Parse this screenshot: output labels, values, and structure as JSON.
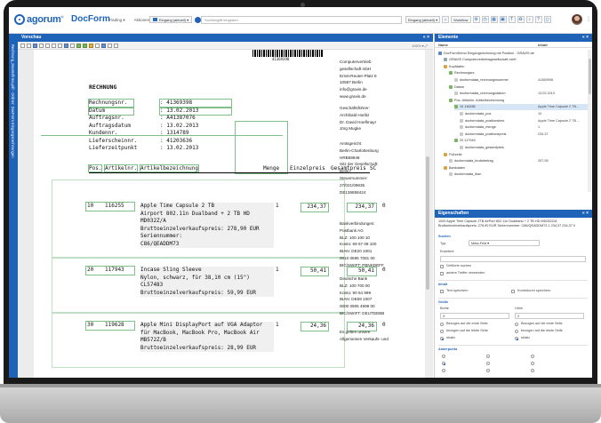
{
  "app": {
    "logo_text": "agorum",
    "logo_sup": "®",
    "name": "DocForm",
    "menu": [
      "Trading ▾",
      "Aktionen ▾"
    ],
    "inbox_label": "Eingang (aktuell) ▾",
    "search_placeholder": "Suchbegriff eingeben",
    "tool_buttons": [
      "Eingang (aktuell) ▾",
      "Workflow"
    ],
    "kebab": "⋮"
  },
  "left_tab": {
    "label": "Rechnung_Musterfirma.pdf - Ordner: DocForm Eingangsrechnungen"
  },
  "viewer": {
    "title": "Vorschau",
    "close": "« ×",
    "zoom": "100%  ▾   ⤢",
    "barcode_number": "41369398",
    "doc_title": "RECHNUNG",
    "meta": [
      {
        "k": "Rechnungsnr.",
        "v": ": 41369398"
      },
      {
        "k": "Datum",
        "v": ": 13.02.2013"
      },
      {
        "k": "Auftragsnr.",
        "v": ": A41387076"
      },
      {
        "k": "Auftragsdatum",
        "v": ": 13.02.2013"
      },
      {
        "k": "Kundennr.",
        "v": ": 1314789"
      },
      {
        "k": "Lieferscheinnr.",
        "v": ": 41203636"
      },
      {
        "k": "Lieferzeitpunkt",
        "v": ": 13.02.2013"
      }
    ],
    "table_head": {
      "pos": "Pos.",
      "art": "Artikelnr.",
      "desc": "Artikelbezeichnung",
      "qty": "Menge",
      "ep": "Einzelpreis",
      "gp": "Gesamtpreis",
      "sc": "SC"
    },
    "items": [
      {
        "pos": "10",
        "art": "116255",
        "lines": [
          "Apple Time Capsule 2 TB",
          "Airport 802.11n Dualband + 2 TB HD",
          "MD032Z/A",
          "Bruttoeinzelverkaufspreis: 278,90 EUR",
          "Seriennummer:",
          "C86/QEADDM73"
        ],
        "qty": "1",
        "ep": "234,37",
        "gp": "234,37",
        "sc": "0"
      },
      {
        "pos": "20",
        "art": "117943",
        "lines": [
          "Incase Sling Sleeve",
          "Nylon, schwarz, für 38,10 cm (15\")",
          "CL57483",
          "Bruttoeinzelverkaufspreis: 59,99 EUR"
        ],
        "qty": "1",
        "ep": "50,41",
        "gp": "50,41",
        "sc": "0"
      },
      {
        "pos": "30",
        "art": "119628",
        "lines": [
          "Apple Mini DisplayPort auf VGA Adaptor",
          "für MacBook, MacBook Pro, MacBook Air",
          "MB572Z/B",
          "Bruttoeinzelverkaufspreis: 28,99 EUR"
        ],
        "qty": "1",
        "ep": "24,36",
        "gp": "24,36",
        "sc": "0"
      }
    ],
    "right_col": {
      "company": [
        "Computervertrieb",
        "gesellschaft mbH",
        "Ernst-Reuter-Platz 8",
        "10587 Berlin",
        "info@gravis.de",
        "www.gravis.de"
      ],
      "mgmt": [
        "Geschäftsführer:",
        "Archibald Horlitz",
        "Dr. David Hoeflmayr",
        "Jörg Mugke"
      ],
      "court": [
        "Amtsgericht",
        "Berlin-Charlottenburg",
        "HRB59948",
        "Sitz der Gesellschaft:",
        "Berlin",
        "Steuernummer:",
        "27/021/09835",
        "DE136858424"
      ],
      "bank1": [
        "Bankverbindungen:",
        "Postbank AG",
        "BLZ: 100 100 10",
        "Konto: 69 57 08 100",
        "IBAN: DE20 1001",
        "0010 0695 7081 00",
        "BIC/SWIFT: PBNKDEFF"
      ],
      "bank2": [
        "Deutsche Bank",
        "BLZ: 100 700 00",
        "Konto: 90 64 999",
        "IBAN: DE69 1007",
        "0000 0906 4999 00",
        "BIC/SWIFT: DEUTDEBB"
      ],
      "footer": [
        "Es gelten unsere",
        "Allgemeinen Verkaufs- und"
      ]
    }
  },
  "elements_panel": {
    "title": "Elemente",
    "controls": "« ×",
    "col_name": "Name",
    "col_value": "Inhalt",
    "rows": [
      {
        "indent": 0,
        "label": "DocFormDemo Eingangsrechnung mit Position - GRAVIS.de",
        "value": "",
        "color": "#5b86c5"
      },
      {
        "indent": 1,
        "label": "GRAVIS Computervertriebsgesellschaft mbH",
        "value": "",
        "color": "#8aa"
      },
      {
        "indent": 1,
        "label": "Kopfdaten",
        "value": "",
        "color": "#d9a441"
      },
      {
        "indent": 2,
        "label": "Rechnungsnr.",
        "value": "",
        "color": "#7cb55e"
      },
      {
        "indent": 3,
        "label": "docformdata_rechnungsnummer",
        "value": "41369398",
        "color": "#c9c9c9"
      },
      {
        "indent": 2,
        "label": "Datum",
        "value": "",
        "color": "#7cb55e"
      },
      {
        "indent": 3,
        "label": "docformdata_rechnungsdatum",
        "value": "13.02.2013",
        "color": "#c9c9c9"
      },
      {
        "indent": 2,
        "label": "Pos. Artikelnr. Artikelbezeichnung",
        "value": "",
        "color": "#7cb55e"
      },
      {
        "indent": 3,
        "label": "10 116255",
        "value": "Apple Time Capsule 2 TB...",
        "color": "#7cb55e"
      },
      {
        "indent": 4,
        "label": "docformdata_pos",
        "value": "10",
        "color": "#c9c9c9"
      },
      {
        "indent": 4,
        "label": "docformdata_positionsbez",
        "value": "Apple Time Capsule 2 TB ...",
        "color": "#c9c9c9"
      },
      {
        "indent": 4,
        "label": "docformdata_menge",
        "value": "1",
        "color": "#c9c9c9"
      },
      {
        "indent": 4,
        "label": "docformdata_positionspreis",
        "value": "234,37",
        "color": "#c9c9c9"
      },
      {
        "indent": 3,
        "label": "20 117943",
        "value": "",
        "color": "#7cb55e"
      },
      {
        "indent": 4,
        "label": "docformdata_gesamtpreis",
        "value": "",
        "color": "#c9c9c9"
      },
      {
        "indent": 1,
        "label": "Fußzeile",
        "value": "",
        "color": "#d9a441"
      },
      {
        "indent": 2,
        "label": "docformdata_bruttobetrag",
        "value": "337,95",
        "color": "#c9c9c9"
      },
      {
        "indent": 1,
        "label": "Bankdaten",
        "value": "",
        "color": "#d9a441"
      },
      {
        "indent": 2,
        "label": "docformdata_iban",
        "value": "",
        "color": "#c9c9c9"
      }
    ]
  },
  "props_panel": {
    "title": "Eigenschaften",
    "controls": "« ×",
    "desc": "1000 Apple Time Capsule 2TB AirPort 802.11n Dualband + 2 TB HD MD032Z/A Bruttoeinzelverkaufspreis: 278,90 EUR Seriennummer: C86/QEADDM73 1 234,37 234,37 0",
    "section_suchen": "Suchen",
    "typ_label": "Typ:",
    "typ_value": "Meta-Feld ▾",
    "erweitert_label": "Erweitert:",
    "chk1": "Geführte suchen",
    "chk2": "andere Treffer verwenden",
    "section_inhalt": "Inhalt",
    "chk3": "Text speichern",
    "chk4": "Korrekturen speichern",
    "section_groesse": "Größe",
    "breite_label": "Breite",
    "breite_value": "3",
    "hoehe_label": "Höhe",
    "hoehe_value": "2",
    "radios_left": [
      "Bezogen auf die erste Seite",
      "bezogen auf die letzte Seite",
      "relativ"
    ],
    "radios_right": [
      "Bezogen auf die erste Seite",
      "bezogen auf die letzte Seite",
      "relativ"
    ],
    "section_ankerpunkt": "Ankerpunkt"
  }
}
